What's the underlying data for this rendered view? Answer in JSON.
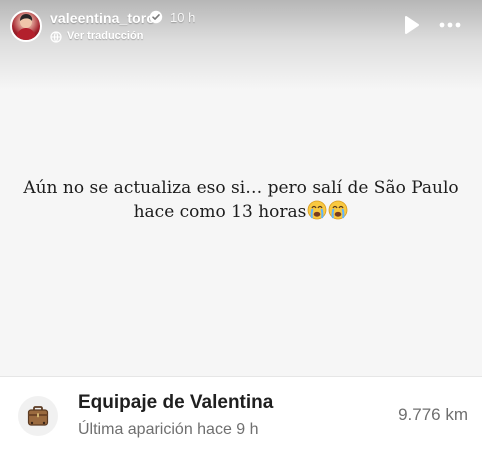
{
  "header": {
    "username": "valeentina_toro",
    "time": "10 h",
    "translate_label": "Ver traducción",
    "play_icon": "play-icon",
    "more_icon": "more-icon",
    "verified_icon": "verified-badge-icon",
    "translate_icon": "globe-icon"
  },
  "story": {
    "text_line1": "Aún no se actualiza eso si… pero salí de São Paulo",
    "text_line2": "hace como 13 horas",
    "emoji_icon": "loudly-crying-face-icon"
  },
  "card": {
    "title": "Equipaje de Valentina",
    "subtitle": "Última aparición hace 9 h",
    "distance": "9.776 km",
    "icon": "luggage-icon"
  },
  "colors": {
    "story_background": "#f6f6f6",
    "card_background": "#ffffff",
    "text_primary": "#1c1c1c",
    "text_secondary": "#6f6f6f",
    "verified": "#3897f0"
  }
}
